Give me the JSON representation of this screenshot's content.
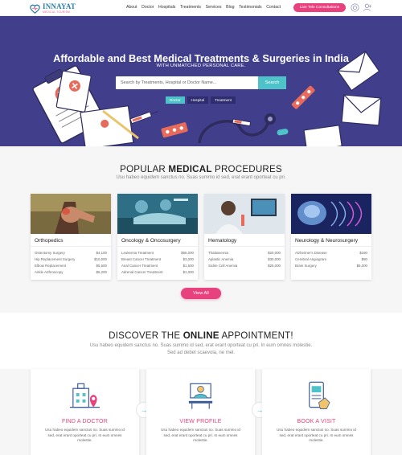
{
  "brand": {
    "name": "INNAYAT",
    "tagline": "MEDICAL TOURISM"
  },
  "nav": {
    "items": [
      "About",
      "Doctor",
      "Hospitals",
      "Treatments",
      "Services",
      "Blog",
      "Testimonials",
      "Contact"
    ],
    "cta": "Live Tele Consultations"
  },
  "hero": {
    "title": "Affordable and Best Medical Treatments & Surgeries in India",
    "subtitle": "WITH UNMATCHED PERSONAL CARE.",
    "search_placeholder": "Search by Treatments, Hospital or Doctor Name...",
    "search_button": "Search",
    "tabs": [
      "Doctor",
      "Hospital",
      "Treatment"
    ]
  },
  "popular": {
    "title_pre": "POPULAR ",
    "title_bold": "MEDICAL",
    "title_post": " PROCEDURES",
    "subtitle": "Usu habeo equidem sanctus no. Suas summo id sed, erat erant oporteat cu pri.",
    "cards": [
      {
        "title": "Orthopedics",
        "rows": [
          [
            "Osteotomy Surgery",
            "$4,100"
          ],
          [
            "Hip Replacement Surgery",
            "$10,000"
          ],
          [
            "Elbow Replacement",
            "$5,500"
          ],
          [
            "Ankle Arthroscopy",
            "$6,200"
          ]
        ]
      },
      {
        "title": "Oncology & Oncosurgery",
        "rows": [
          [
            "Leukemia Treatment",
            "$55,000"
          ],
          [
            "Breast Cancer Treatment",
            "$3,000"
          ],
          [
            "Anal Cancer Treatment",
            "$1,500"
          ],
          [
            "Adrenal Cancer Treatment",
            "$1,000"
          ]
        ]
      },
      {
        "title": "Hematology",
        "rows": [
          [
            "Thalassemia",
            "$20,000"
          ],
          [
            "Aplastic Anemia",
            "$30,000"
          ],
          [
            "Sickle Cell Anemia",
            "$25,000"
          ]
        ]
      },
      {
        "title": "Neurology & Neurosurgery",
        "rows": [
          [
            "Alzheimer's Disease",
            "$180"
          ],
          [
            "Cerebral Angiogram",
            "$80"
          ],
          [
            "Brain Surgery",
            "$5,000"
          ]
        ]
      }
    ],
    "view_all": "View All"
  },
  "discover": {
    "title_pre": "DISCOVER THE ",
    "title_bold": "ONLINE",
    "title_post": " APPOINTMENT!",
    "subtitle_1": "Usu habeo equidem sanctus no. Suas summo id sed, erat erant oporteat cu pri. In eum omnes molestie.",
    "subtitle_2": "Sed ad debet scaevola, ne mel.",
    "steps": [
      {
        "title": "FIND A DOCTOR",
        "text": "Usu habeo equidem sanctus no. Suas summo id sed, erat erant oporteat cu pri. In eum omnes molestie."
      },
      {
        "title": "VIEW PROFILE",
        "text": "Usu habeo equidem sanctus no. Suas summo id sed, erat erant oporteat cu pri. In eum omnes molestie."
      },
      {
        "title": "BOOK A VISIT",
        "text": "Usu habeo equidem sanctus no. Suas summo id sed, erat erant oporteat cu pri. In eum omnes molestie."
      }
    ]
  },
  "colors": {
    "hero_bg": "#413f8c",
    "accent_pink": "#e8427e",
    "accent_teal": "#4ec2c9",
    "brand_blue": "#2a7fa8"
  },
  "icons": [
    "logo-heart-icon",
    "help-icon",
    "add-user-icon",
    "arrow-right-icon"
  ]
}
